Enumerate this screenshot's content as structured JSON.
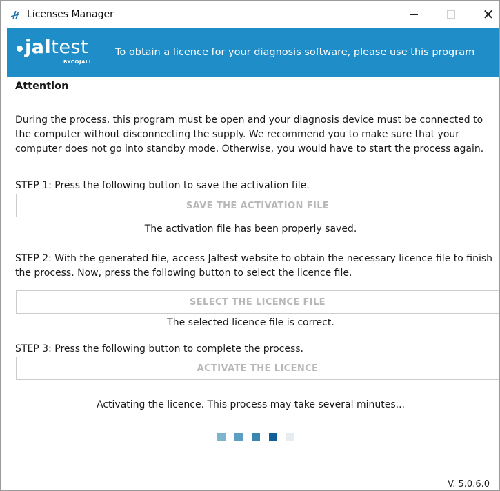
{
  "window": {
    "title": "Licenses Manager",
    "controls": {
      "minimize": "—",
      "close": "✕"
    }
  },
  "banner": {
    "logo_prefix": "",
    "logo_bold": "jal",
    "logo_rest": "test",
    "logo_sub": "BYCOJALI",
    "tagline": "To obtain a licence for your diagnosis software, please use this program",
    "color": "#1f8dc7"
  },
  "content": {
    "attention": "Attention",
    "paragraph": "During the process, this program must be open and your diagnosis device must be connected to the computer without disconnecting the supply. We recommend you to make sure that your computer does not go into standby mode. Otherwise, you would have to start the process again.",
    "step1": {
      "text": "STEP 1: Press the following button to save the activation file.",
      "button": "SAVE THE ACTIVATION FILE",
      "status": "The activation file has been properly saved."
    },
    "step2": {
      "text": "STEP 2: With the generated file, access Jaltest website to obtain the necessary licence file to finish the process. Now, press the following button to select the licence file.",
      "button": "SELECT THE LICENCE FILE",
      "status": "The selected licence file is correct."
    },
    "step3": {
      "text": "STEP 3: Press the following button to complete the process.",
      "button": "ACTIVATE THE LICENCE",
      "status": "Activating the licence. This process may take several minutes..."
    },
    "progress": {
      "colors": [
        "#7fb4cf",
        "#5c9fc2",
        "#3a87b0",
        "#0f5f98",
        "#e6edf2"
      ]
    }
  },
  "footer": {
    "version": "V. 5.0.6.0"
  }
}
